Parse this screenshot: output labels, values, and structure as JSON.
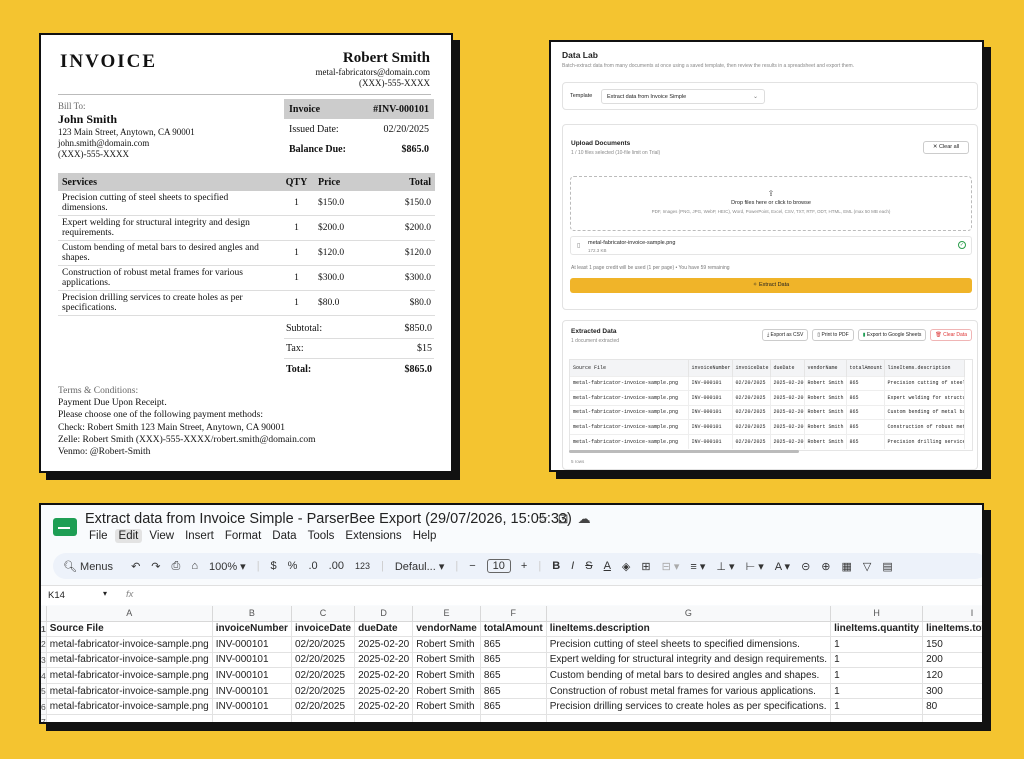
{
  "invoice": {
    "title": "INVOICE",
    "seller": {
      "name": "Robert Smith",
      "email": "metal-fabricators@domain.com",
      "phone": "(XXX)-555-XXXX"
    },
    "bill_to_label": "Bill To:",
    "bill_to": {
      "name": "John Smith",
      "address": "123 Main Street, Anytown, CA 90001",
      "email": "john.smith@domain.com",
      "phone": "(XXX)-555-XXXX"
    },
    "meta": {
      "invoice_label": "Invoice",
      "invoice_no": "#INV-000101",
      "issued_label": "Issued Date:",
      "issued": "02/20/2025",
      "balance_label": "Balance Due:",
      "balance": "$865.0"
    },
    "columns": [
      "Services",
      "QTY",
      "Price",
      "Total"
    ],
    "items": [
      {
        "service": "Precision cutting of steel sheets to specified dimensions.",
        "qty": "1",
        "price": "$150.0",
        "total": "$150.0"
      },
      {
        "service": "Expert welding for structural integrity and design requirements.",
        "qty": "1",
        "price": "$200.0",
        "total": "$200.0"
      },
      {
        "service": "Custom bending of metal bars to desired angles and shapes.",
        "qty": "1",
        "price": "$120.0",
        "total": "$120.0"
      },
      {
        "service": "Construction of robust metal frames for various applications.",
        "qty": "1",
        "price": "$300.0",
        "total": "$300.0"
      },
      {
        "service": "Precision drilling services to create holes as per specifications.",
        "qty": "1",
        "price": "$80.0",
        "total": "$80.0"
      }
    ],
    "subtotal_label": "Subtotal:",
    "subtotal": "$850.0",
    "tax_label": "Tax:",
    "tax": "$15",
    "total_label": "Total:",
    "total": "$865.0",
    "terms_label": "Terms & Conditions:",
    "terms": [
      "Payment Due Upon Receipt.",
      "Please choose one of the following payment methods:",
      "Check: Robert Smith 123 Main Street, Anytown, CA 90001",
      "Zelle: Robert Smith (XXX)-555-XXXX/robert.smith@domain.com",
      "Venmo: @Robert-Smith"
    ]
  },
  "datalab": {
    "title": "Data Lab",
    "subtitle": "Batch-extract data from many documents at once using a saved template, then review the results in a spreadsheet and export them.",
    "template_label": "Template",
    "template_value": "Extract data from Invoice Simple",
    "upload_title": "Upload Documents",
    "upload_sub": "1 / 10 files selected (10-file limit on Trial)",
    "clear_all": "Clear all",
    "drop_title": "Drop files here or click to browse",
    "drop_sub": "PDF, Images (PNG, JPG, WebP, HEIC), Word, PowerPoint, Excel, CSV, TXT, RTF, ODT, HTML, EML (max 50 MB each)",
    "file_name": "metal-fabricator-invoice-sample.png",
    "file_size": "172.3 KB",
    "credit_note": "At least 1 page credit will be used (1 per page) • You have 59 remaining",
    "extract_button": "Extract Data",
    "extracted_title": "Extracted Data",
    "extracted_sub": "1 document extracted",
    "export_csv": "Export as CSV",
    "print_pdf": "Print to PDF",
    "export_sheets": "Export to Google Sheets",
    "clear_data": "Clear Data",
    "columns": [
      "Source File",
      "invoiceNumber",
      "invoiceDate",
      "dueDate",
      "vendorName",
      "totalAmount",
      "lineItems.description"
    ],
    "rows": [
      [
        "metal-fabricator-invoice-sample.png",
        "INV-000101",
        "02/20/2025",
        "2025-02-20",
        "Robert Smith",
        "865",
        "Precision cutting of steel sheets"
      ],
      [
        "metal-fabricator-invoice-sample.png",
        "INV-000101",
        "02/20/2025",
        "2025-02-20",
        "Robert Smith",
        "865",
        "Expert welding for structural"
      ],
      [
        "metal-fabricator-invoice-sample.png",
        "INV-000101",
        "02/20/2025",
        "2025-02-20",
        "Robert Smith",
        "865",
        "Custom bending of metal bars"
      ],
      [
        "metal-fabricator-invoice-sample.png",
        "INV-000101",
        "02/20/2025",
        "2025-02-20",
        "Robert Smith",
        "865",
        "Construction of robust metal"
      ],
      [
        "metal-fabricator-invoice-sample.png",
        "INV-000101",
        "02/20/2025",
        "2025-02-20",
        "Robert Smith",
        "865",
        "Precision drilling services"
      ]
    ],
    "row_count": "5 rows"
  },
  "sheets": {
    "doc_title": "Extract data from Invoice Simple - ParserBee Export (29/07/2026, 15:05:33)",
    "menu": [
      "File",
      "Edit",
      "View",
      "Insert",
      "Format",
      "Data",
      "Tools",
      "Extensions",
      "Help"
    ],
    "search_label": "Menus",
    "zoom": "100%",
    "currency": "$",
    "percent": "%",
    "dec_less": ".0",
    "dec_more": ".00",
    "number_format": "123",
    "font": "Defaul...",
    "font_size": "10",
    "bold": "B",
    "italic": "I",
    "cell_ref": "K14",
    "fx": "fx",
    "col_letters": [
      "A",
      "B",
      "C",
      "D",
      "E",
      "F",
      "G",
      "H",
      "I"
    ],
    "header_row": [
      "Source File",
      "invoiceNumber",
      "invoiceDate",
      "dueDate",
      "vendorName",
      "totalAmount",
      "lineItems.description",
      "lineItems.quantity",
      "lineItems.totalPrice"
    ],
    "rows": [
      [
        "metal-fabricator-invoice-sample.png",
        "INV-000101",
        "02/20/2025",
        "2025-02-20",
        "Robert Smith",
        "865",
        "Precision cutting of steel sheets to specified dimensions.",
        "1",
        "150"
      ],
      [
        "metal-fabricator-invoice-sample.png",
        "INV-000101",
        "02/20/2025",
        "2025-02-20",
        "Robert Smith",
        "865",
        "Expert welding for structural integrity and design requirements.",
        "1",
        "200"
      ],
      [
        "metal-fabricator-invoice-sample.png",
        "INV-000101",
        "02/20/2025",
        "2025-02-20",
        "Robert Smith",
        "865",
        "Custom bending of metal bars to desired angles and shapes.",
        "1",
        "120"
      ],
      [
        "metal-fabricator-invoice-sample.png",
        "INV-000101",
        "02/20/2025",
        "2025-02-20",
        "Robert Smith",
        "865",
        "Construction of robust metal frames for various applications.",
        "1",
        "300"
      ],
      [
        "metal-fabricator-invoice-sample.png",
        "INV-000101",
        "02/20/2025",
        "2025-02-20",
        "Robert Smith",
        "865",
        "Precision drilling services to create holes as per specifications.",
        "1",
        "80"
      ]
    ],
    "row_numbers": [
      "1",
      "2",
      "3",
      "4",
      "5",
      "6",
      "7"
    ]
  }
}
